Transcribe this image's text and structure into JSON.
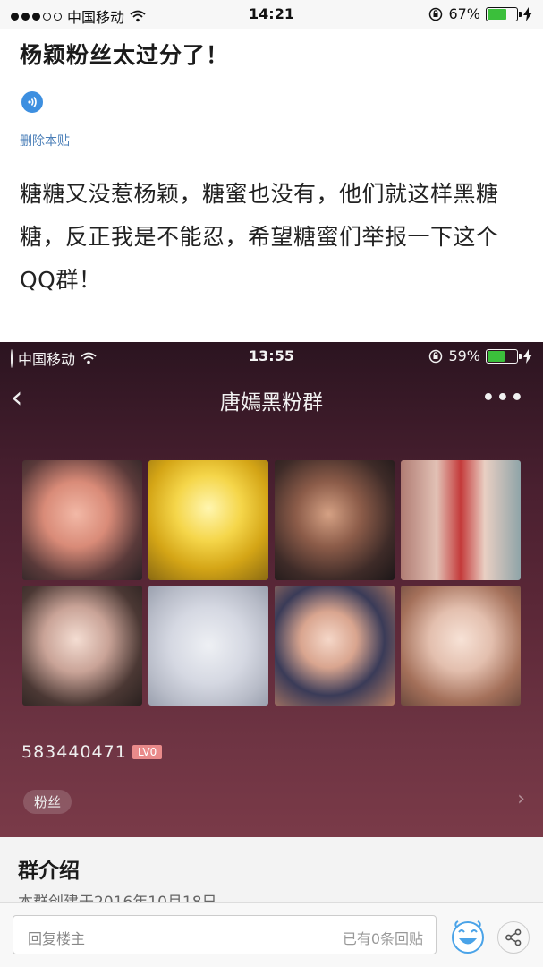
{
  "statusbar": {
    "carrier": "中国移动",
    "time": "14:21",
    "battery": "67%",
    "battery_level": 0.67
  },
  "post": {
    "title": "杨颖粉丝太过分了！",
    "delete_link": "删除本贴",
    "body": "糖糖又没惹杨颖，糖蜜也没有，他们就这样黑糖糖，反正我是不能忍，希望糖蜜们举报一下这个QQ群！"
  },
  "screenshot": {
    "status": {
      "carrier": "中国移动",
      "time": "13:55",
      "battery": "59%",
      "battery_level": 0.59
    },
    "nav": {
      "back": "‹",
      "title": "唐嫣黑粉群",
      "more": "•••"
    },
    "group_id": "583440471",
    "level_badge": "LV0",
    "tag": "粉丝"
  },
  "intro": {
    "heading": "群介绍",
    "text": "本群创建于2016年10月18日"
  },
  "reply_bar": {
    "placeholder": "回复楼主",
    "count": "已有0条回贴"
  },
  "icons": {
    "wifi": "wifi-icon",
    "audio": "audio-icon",
    "emoji": "emoji-icon",
    "share": "share-icon"
  },
  "colors": {
    "link": "#4b7fb8",
    "audio_icon": "#3d8fe0",
    "battery": "#3bbf3b",
    "badge": "#e98a8a"
  }
}
